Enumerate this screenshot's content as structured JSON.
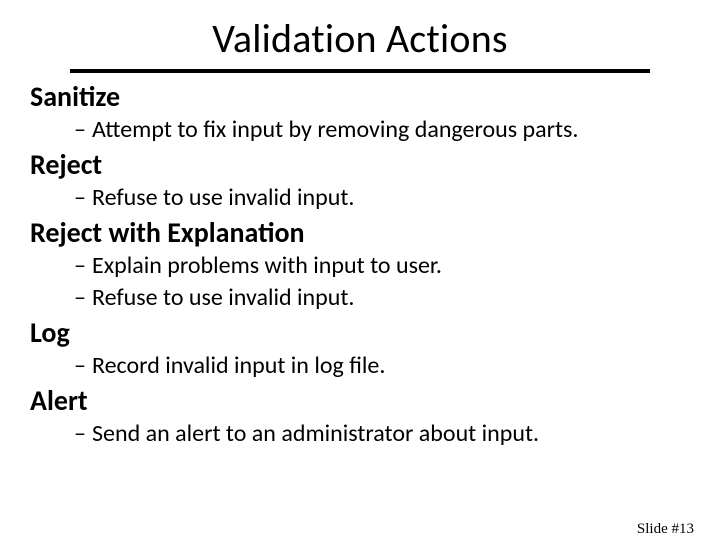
{
  "title": "Validation Actions",
  "sections": [
    {
      "heading": "Sanitize",
      "bullets": [
        "Attempt to fix input by removing dangerous parts."
      ]
    },
    {
      "heading": "Reject",
      "bullets": [
        "Refuse to use invalid input."
      ]
    },
    {
      "heading": "Reject with Explanation",
      "bullets": [
        "Explain problems with input to user.",
        "Refuse to use invalid input."
      ]
    },
    {
      "heading": "Log",
      "bullets": [
        "Record invalid input in log file."
      ]
    },
    {
      "heading": "Alert",
      "bullets": [
        "Send an alert to an administrator about input."
      ]
    }
  ],
  "footer": "Slide #13",
  "dash": "–"
}
